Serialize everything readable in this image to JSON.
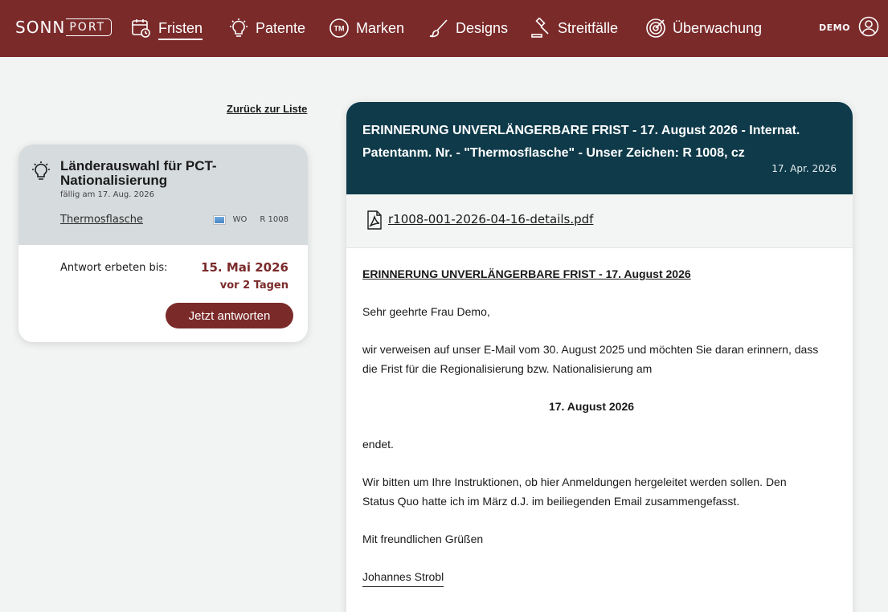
{
  "brand": {
    "part1": "SONN",
    "part2": "PORT"
  },
  "nav": {
    "items": [
      {
        "label": "Fristen",
        "icon": "calendar-clock-icon",
        "active": true
      },
      {
        "label": "Patente",
        "icon": "lightbulb-icon"
      },
      {
        "label": "Marken",
        "icon": "trademark-icon"
      },
      {
        "label": "Designs",
        "icon": "brush-icon"
      },
      {
        "label": "Streitfälle",
        "icon": "gavel-icon"
      },
      {
        "label": "Überwachung",
        "icon": "target-icon"
      }
    ],
    "user_label": "DEMO"
  },
  "back_link": "Zurück zur Liste",
  "task": {
    "title": "Länderauswahl für PCT-Nationalisierung",
    "due": "fällig am 17. Aug. 2026",
    "case_link": "Thermosflasche",
    "region": "WO",
    "reference": "R 1008",
    "answer_label": "Antwort erbeten bis:",
    "answer_date": "15. Mai 2026",
    "answer_ago": "vor 2 Tagen",
    "reply_button": "Jetzt antworten"
  },
  "message": {
    "subject": "ERINNERUNG UNVERLÄNGERBARE FRIST - 17. August 2026 - Internat. Patentanm. Nr. - \"Thermosflasche\" - Unser Zeichen: R 1008, cz",
    "date": "17. Apr. 2026",
    "attachment": "r1008-001-2026-04-16-details.pdf",
    "body": {
      "heading": "ERINNERUNG UNVERLÄNGERBARE FRIST - 17. August 2026",
      "greeting": "Sehr geehrte Frau Demo,",
      "para1": "wir verweisen auf unser E-Mail vom 30. August 2025 und möchten Sie daran erinnern, dass die Frist für die Regionalisierung bzw. Nationalisierung am",
      "deadline": "17. August 2026",
      "para2": "endet.",
      "para3": "Wir bitten um Ihre Instruktionen, ob hier Anmeldungen hergeleitet werden sollen. Den Status Quo hatte ich im März d.J. im beiliegenden Email zusammengefasst.",
      "closing": "Mit freundlichen Grüßen",
      "signature": "Johannes Strobl"
    }
  },
  "colors": {
    "brand": "#7b2a2a",
    "header": "#0e3a4a",
    "card_head": "#d6dbdd"
  }
}
